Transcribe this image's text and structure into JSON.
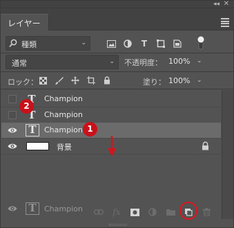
{
  "window": {
    "collapse_glyph": "◂◂",
    "close_glyph": "✕"
  },
  "tab": {
    "label": "レイヤー"
  },
  "filter": {
    "kind_label": "種類",
    "icons": [
      "image-filter-icon",
      "adjustment-filter-icon",
      "type-filter-icon",
      "shape-filter-icon",
      "smart-object-filter-icon",
      "filter-toggle-icon"
    ]
  },
  "blend": {
    "mode": "通常",
    "opacity_label": "不透明度：",
    "opacity_value": "100%"
  },
  "lock": {
    "label": "ロック：",
    "icons": [
      "lock-transparent-pixels-icon",
      "lock-image-pixels-icon",
      "lock-position-icon",
      "lock-artboard-icon",
      "lock-all-icon"
    ],
    "fill_label": "塗り：",
    "fill_value": "100%"
  },
  "layers": [
    {
      "name": "Champion",
      "visible": false,
      "type": "text",
      "selected": false
    },
    {
      "name": "Champion",
      "visible": false,
      "type": "text",
      "selected": false
    },
    {
      "name": "Champion",
      "visible": true,
      "type": "text",
      "selected": true
    },
    {
      "name": "背景",
      "visible": true,
      "type": "background",
      "locked": true,
      "selected": false
    }
  ],
  "drag_ghost": {
    "name": "Champion"
  },
  "annotations": [
    {
      "label": "1",
      "color": "#c8111a"
    },
    {
      "label": "2",
      "color": "#c8111a"
    }
  ],
  "bottom_bar": {
    "icons": [
      "link-layers-icon",
      "fx-icon",
      "add-mask-icon",
      "new-adjustment-icon",
      "new-group-icon",
      "new-layer-icon",
      "delete-layer-icon"
    ],
    "fx_label": "fx",
    "highlighted": "new-layer-icon",
    "highlight_color": "#e0141e"
  }
}
